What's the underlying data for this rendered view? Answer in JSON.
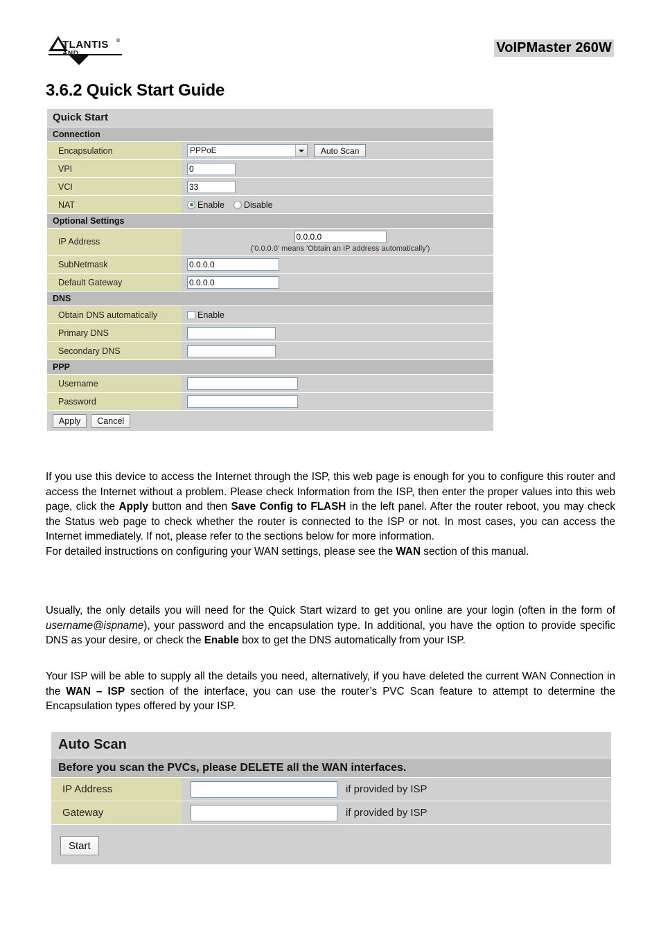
{
  "header": {
    "logo_name": "atlantis-land-logo",
    "logo_text_primary": "ATLANTIS",
    "logo_text_secondary": "LAND",
    "device_model": "VoIPMaster 260W"
  },
  "section_heading": "3.6.2 Quick Start Guide",
  "quick_start": {
    "title": "Quick Start",
    "sections": {
      "connection": {
        "header": "Connection",
        "encapsulation": {
          "label": "Encapsulation",
          "value": "PPPoE",
          "auto_scan_button": "Auto Scan"
        },
        "vpi": {
          "label": "VPI",
          "value": "0"
        },
        "vci": {
          "label": "VCI",
          "value": "33"
        },
        "nat": {
          "label": "NAT",
          "enable_label": "Enable",
          "disable_label": "Disable",
          "selected": "Enable"
        }
      },
      "optional_settings": {
        "header": "Optional Settings",
        "ip_address": {
          "label": "IP Address",
          "value": "0.0.0.0",
          "hint": "('0.0.0.0' means 'Obtain an IP address automatically')"
        },
        "subnetmask": {
          "label": "SubNetmask",
          "value": "0.0.0.0"
        },
        "default_gateway": {
          "label": "Default Gateway",
          "value": "0.0.0.0"
        }
      },
      "dns": {
        "header": "DNS",
        "obtain_dns": {
          "label": "Obtain DNS automatically",
          "checkbox_label": "Enable",
          "checked": false
        },
        "primary_dns": {
          "label": "Primary DNS",
          "value": ""
        },
        "secondary_dns": {
          "label": "Secondary DNS",
          "value": ""
        }
      },
      "ppp": {
        "header": "PPP",
        "username": {
          "label": "Username",
          "value": ""
        },
        "password": {
          "label": "Password",
          "value": ""
        }
      }
    },
    "buttons": {
      "apply": "Apply",
      "cancel": "Cancel"
    }
  },
  "body_text": {
    "paragraph_1": {
      "part_1": "If you use this device to access the Internet through the ISP, this web page is enough for you to configure this router and access the Internet without a problem. Please check Information from the ISP, then enter the proper values into this web page, click the ",
      "bold_1": "Apply",
      "part_2": " button and then ",
      "bold_2": "Save Config to FLASH",
      "part_3": " in the left panel. After the router reboot, you may check the Status web page to check whether the router is connected to the ISP or not. In most cases, you can access the Internet immediately. If not, please refer to the sections below for more information."
    },
    "paragraph_2": {
      "part_1": "For detailed instructions on configuring your WAN settings, please see the ",
      "bold_1": "WAN",
      "part_2": " section of this manual."
    },
    "paragraph_3": {
      "part_1": "Usually, the only details you will need for the Quick Start wizard to get you online are your login (often in the form of ",
      "italic_1": "username@ispname",
      "part_2": "), your password and the encapsulation type.  In additional, you have the option to provide specific DNS as your desire, or check the ",
      "bold_1": "Enable",
      "part_3": " box to get the DNS automatically from your ISP."
    },
    "paragraph_4": {
      "part_1": "Your ISP will be able to supply all the details you need, alternatively, if you have deleted the current WAN Connection in the ",
      "bold_1": "WAN – ISP",
      "part_2": " section of the interface, you can use the router’s PVC Scan feature to attempt to determine the Encapsulation types offered by your ISP."
    }
  },
  "auto_scan": {
    "title": "Auto Scan",
    "warning": "Before you scan the PVCs, please DELETE all the WAN interfaces.",
    "ip_address": {
      "label": "IP Address",
      "value": "",
      "note": "if provided by ISP"
    },
    "gateway": {
      "label": "Gateway",
      "value": "",
      "note": "if provided by ISP"
    },
    "start_button": "Start"
  },
  "colors": {
    "panel_title_bg": "#d2d2d2",
    "section_header_bg": "#bcbcbc",
    "row_bg": "#d0d0d0",
    "label_bg": "#dcdcb0",
    "input_border": "#7f9db9",
    "radio_selected": "#3f8f3f",
    "highlight_bg": "#d4d4d4"
  }
}
